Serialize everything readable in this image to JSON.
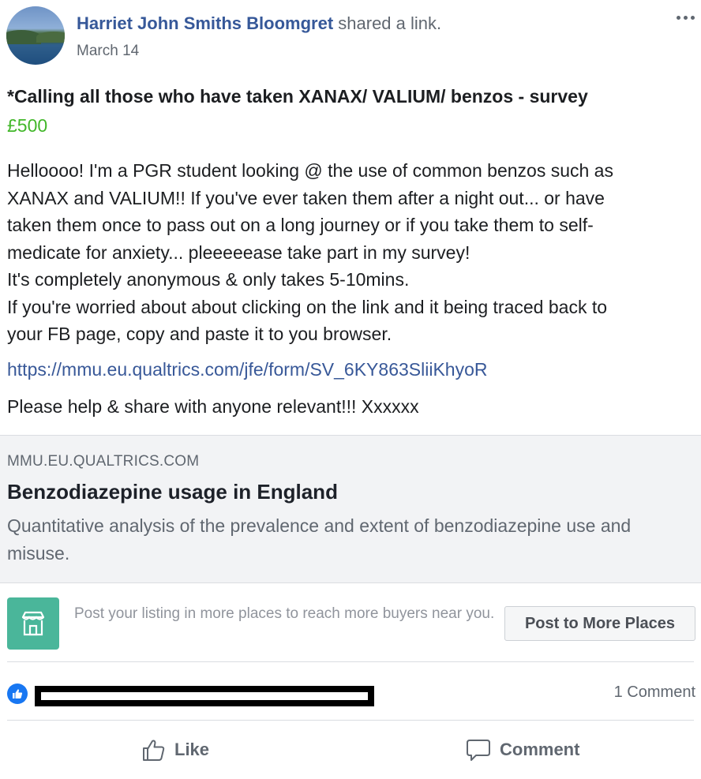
{
  "post": {
    "author": "Harriet John Smiths Bloomgret",
    "action": " shared a link.",
    "date": "March 14",
    "more_icon": "ellipsis-icon"
  },
  "listing_post": {
    "title": "*Calling all those who have taken XANAX/ VALIUM/ benzos - survey",
    "price": "£500",
    "body_lines": [
      "Helloooo! I'm a PGR student looking @ the use of common benzos such as",
      "XANAX and VALIUM!! If you've ever taken them after a night out... or have",
      "taken them once to pass out on a long journey or if you take them to self-",
      "medicate for anxiety... pleeeeease take part in my survey!",
      "It's completely anonymous & only takes 5-10mins.",
      "If you're worried about about clicking on the link and it being traced back to",
      "your FB page, copy and paste it to you browser."
    ],
    "link": "https://mmu.eu.qualtrics.com/jfe/form/SV_6KY863SliiKhyoR",
    "closing": "Please help & share with anyone relevant!!! Xxxxxx"
  },
  "link_preview": {
    "domain": "MMU.EU.QUALTRICS.COM",
    "title": "Benzodiazepine usage in England",
    "description": "Quantitative analysis of the prevalence and extent of benzodiazepine use and misuse."
  },
  "marketplace_prompt": {
    "icon": "storefront-icon",
    "text": "Post your listing in more places to reach more buyers near you.",
    "button": "Post to More Places"
  },
  "reactions": {
    "icon": "like-reaction-icon",
    "comment_count": "1 Comment"
  },
  "actions": {
    "like": "Like",
    "comment": "Comment"
  },
  "colors": {
    "author_link": "#365899",
    "price": "#42b72a",
    "url": "#385898",
    "listing_icon_bg": "#4ab69a",
    "like_badge": "#1877f2"
  }
}
